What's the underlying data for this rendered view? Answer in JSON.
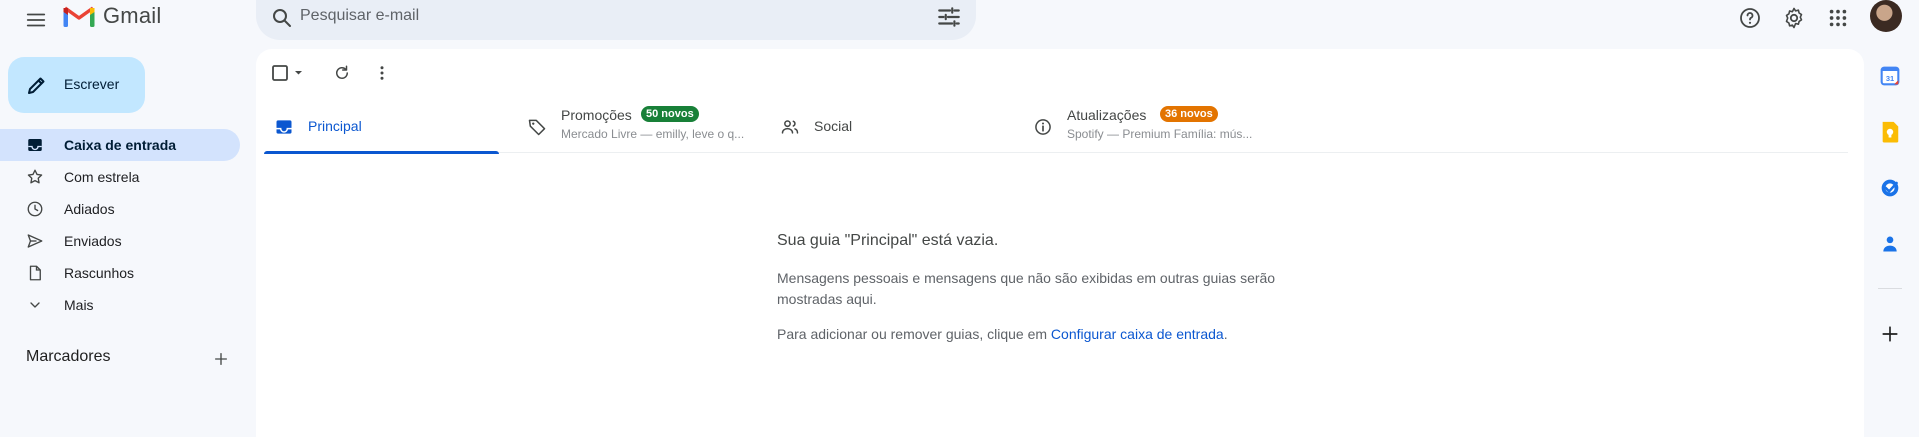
{
  "app": {
    "name": "Gmail"
  },
  "search": {
    "placeholder": "Pesquisar e-mail"
  },
  "compose": {
    "label": "Escrever"
  },
  "nav": {
    "items": [
      {
        "label": "Caixa de entrada",
        "active": true
      },
      {
        "label": "Com estrela"
      },
      {
        "label": "Adiados"
      },
      {
        "label": "Enviados"
      },
      {
        "label": "Rascunhos"
      },
      {
        "label": "Mais"
      }
    ]
  },
  "labels": {
    "title": "Marcadores"
  },
  "tabs": [
    {
      "label": "Principal",
      "icon": "inbox-icon"
    },
    {
      "label": "Promoções",
      "badge": "50 novos",
      "badge_color": "#188038",
      "snippet": "Mercado Livre — emilly, leve o q...",
      "icon": "tag-icon"
    },
    {
      "label": "Social",
      "icon": "people-icon"
    },
    {
      "label": "Atualizações",
      "badge": "36 novos",
      "badge_color": "#e37400",
      "snippet": "Spotify — Premium Família: mús...",
      "icon": "info-icon"
    }
  ],
  "empty_state": {
    "title": "Sua guia \"Principal\" está vazia.",
    "body": "Mensagens pessoais e mensagens que não são exibidas em outras guias serão mostradas aqui.",
    "cta_prefix": "Para adicionar ou remover guias, clique em ",
    "cta_link": "Configurar caixa de entrada",
    "cta_suffix": "."
  },
  "calendar_day": "31",
  "colors": {
    "accent": "#0b57d0",
    "compose_bg": "#c2e7ff",
    "active_nav_bg": "#d3e3fd",
    "app_bg": "#f6f8fc"
  }
}
